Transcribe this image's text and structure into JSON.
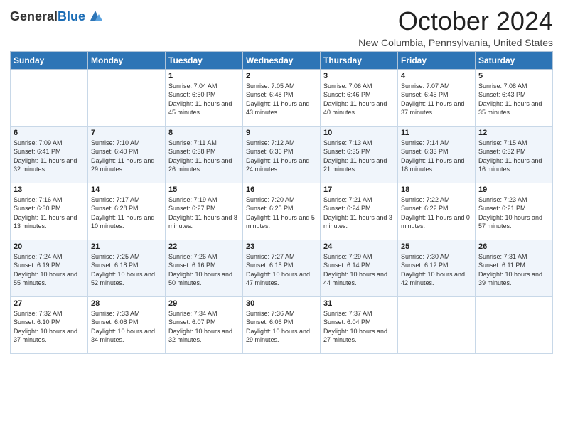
{
  "logo": {
    "general": "General",
    "blue": "Blue"
  },
  "header": {
    "month_title": "October 2024",
    "location": "New Columbia, Pennsylvania, United States"
  },
  "days_of_week": [
    "Sunday",
    "Monday",
    "Tuesday",
    "Wednesday",
    "Thursday",
    "Friday",
    "Saturday"
  ],
  "weeks": [
    [
      {
        "day": "",
        "sunrise": "",
        "sunset": "",
        "daylight": ""
      },
      {
        "day": "",
        "sunrise": "",
        "sunset": "",
        "daylight": ""
      },
      {
        "day": "1",
        "sunrise": "Sunrise: 7:04 AM",
        "sunset": "Sunset: 6:50 PM",
        "daylight": "Daylight: 11 hours and 45 minutes."
      },
      {
        "day": "2",
        "sunrise": "Sunrise: 7:05 AM",
        "sunset": "Sunset: 6:48 PM",
        "daylight": "Daylight: 11 hours and 43 minutes."
      },
      {
        "day": "3",
        "sunrise": "Sunrise: 7:06 AM",
        "sunset": "Sunset: 6:46 PM",
        "daylight": "Daylight: 11 hours and 40 minutes."
      },
      {
        "day": "4",
        "sunrise": "Sunrise: 7:07 AM",
        "sunset": "Sunset: 6:45 PM",
        "daylight": "Daylight: 11 hours and 37 minutes."
      },
      {
        "day": "5",
        "sunrise": "Sunrise: 7:08 AM",
        "sunset": "Sunset: 6:43 PM",
        "daylight": "Daylight: 11 hours and 35 minutes."
      }
    ],
    [
      {
        "day": "6",
        "sunrise": "Sunrise: 7:09 AM",
        "sunset": "Sunset: 6:41 PM",
        "daylight": "Daylight: 11 hours and 32 minutes."
      },
      {
        "day": "7",
        "sunrise": "Sunrise: 7:10 AM",
        "sunset": "Sunset: 6:40 PM",
        "daylight": "Daylight: 11 hours and 29 minutes."
      },
      {
        "day": "8",
        "sunrise": "Sunrise: 7:11 AM",
        "sunset": "Sunset: 6:38 PM",
        "daylight": "Daylight: 11 hours and 26 minutes."
      },
      {
        "day": "9",
        "sunrise": "Sunrise: 7:12 AM",
        "sunset": "Sunset: 6:36 PM",
        "daylight": "Daylight: 11 hours and 24 minutes."
      },
      {
        "day": "10",
        "sunrise": "Sunrise: 7:13 AM",
        "sunset": "Sunset: 6:35 PM",
        "daylight": "Daylight: 11 hours and 21 minutes."
      },
      {
        "day": "11",
        "sunrise": "Sunrise: 7:14 AM",
        "sunset": "Sunset: 6:33 PM",
        "daylight": "Daylight: 11 hours and 18 minutes."
      },
      {
        "day": "12",
        "sunrise": "Sunrise: 7:15 AM",
        "sunset": "Sunset: 6:32 PM",
        "daylight": "Daylight: 11 hours and 16 minutes."
      }
    ],
    [
      {
        "day": "13",
        "sunrise": "Sunrise: 7:16 AM",
        "sunset": "Sunset: 6:30 PM",
        "daylight": "Daylight: 11 hours and 13 minutes."
      },
      {
        "day": "14",
        "sunrise": "Sunrise: 7:17 AM",
        "sunset": "Sunset: 6:28 PM",
        "daylight": "Daylight: 11 hours and 10 minutes."
      },
      {
        "day": "15",
        "sunrise": "Sunrise: 7:19 AM",
        "sunset": "Sunset: 6:27 PM",
        "daylight": "Daylight: 11 hours and 8 minutes."
      },
      {
        "day": "16",
        "sunrise": "Sunrise: 7:20 AM",
        "sunset": "Sunset: 6:25 PM",
        "daylight": "Daylight: 11 hours and 5 minutes."
      },
      {
        "day": "17",
        "sunrise": "Sunrise: 7:21 AM",
        "sunset": "Sunset: 6:24 PM",
        "daylight": "Daylight: 11 hours and 3 minutes."
      },
      {
        "day": "18",
        "sunrise": "Sunrise: 7:22 AM",
        "sunset": "Sunset: 6:22 PM",
        "daylight": "Daylight: 11 hours and 0 minutes."
      },
      {
        "day": "19",
        "sunrise": "Sunrise: 7:23 AM",
        "sunset": "Sunset: 6:21 PM",
        "daylight": "Daylight: 10 hours and 57 minutes."
      }
    ],
    [
      {
        "day": "20",
        "sunrise": "Sunrise: 7:24 AM",
        "sunset": "Sunset: 6:19 PM",
        "daylight": "Daylight: 10 hours and 55 minutes."
      },
      {
        "day": "21",
        "sunrise": "Sunrise: 7:25 AM",
        "sunset": "Sunset: 6:18 PM",
        "daylight": "Daylight: 10 hours and 52 minutes."
      },
      {
        "day": "22",
        "sunrise": "Sunrise: 7:26 AM",
        "sunset": "Sunset: 6:16 PM",
        "daylight": "Daylight: 10 hours and 50 minutes."
      },
      {
        "day": "23",
        "sunrise": "Sunrise: 7:27 AM",
        "sunset": "Sunset: 6:15 PM",
        "daylight": "Daylight: 10 hours and 47 minutes."
      },
      {
        "day": "24",
        "sunrise": "Sunrise: 7:29 AM",
        "sunset": "Sunset: 6:14 PM",
        "daylight": "Daylight: 10 hours and 44 minutes."
      },
      {
        "day": "25",
        "sunrise": "Sunrise: 7:30 AM",
        "sunset": "Sunset: 6:12 PM",
        "daylight": "Daylight: 10 hours and 42 minutes."
      },
      {
        "day": "26",
        "sunrise": "Sunrise: 7:31 AM",
        "sunset": "Sunset: 6:11 PM",
        "daylight": "Daylight: 10 hours and 39 minutes."
      }
    ],
    [
      {
        "day": "27",
        "sunrise": "Sunrise: 7:32 AM",
        "sunset": "Sunset: 6:10 PM",
        "daylight": "Daylight: 10 hours and 37 minutes."
      },
      {
        "day": "28",
        "sunrise": "Sunrise: 7:33 AM",
        "sunset": "Sunset: 6:08 PM",
        "daylight": "Daylight: 10 hours and 34 minutes."
      },
      {
        "day": "29",
        "sunrise": "Sunrise: 7:34 AM",
        "sunset": "Sunset: 6:07 PM",
        "daylight": "Daylight: 10 hours and 32 minutes."
      },
      {
        "day": "30",
        "sunrise": "Sunrise: 7:36 AM",
        "sunset": "Sunset: 6:06 PM",
        "daylight": "Daylight: 10 hours and 29 minutes."
      },
      {
        "day": "31",
        "sunrise": "Sunrise: 7:37 AM",
        "sunset": "Sunset: 6:04 PM",
        "daylight": "Daylight: 10 hours and 27 minutes."
      },
      {
        "day": "",
        "sunrise": "",
        "sunset": "",
        "daylight": ""
      },
      {
        "day": "",
        "sunrise": "",
        "sunset": "",
        "daylight": ""
      }
    ]
  ]
}
